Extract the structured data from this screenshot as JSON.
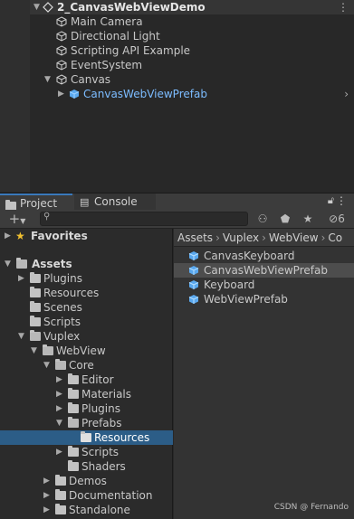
{
  "hierarchy": {
    "scene_name": "2_CanvasWebViewDemo",
    "items": [
      {
        "label": "Main Camera"
      },
      {
        "label": "Directional Light"
      },
      {
        "label": "Scripting API Example"
      },
      {
        "label": "EventSystem"
      },
      {
        "label": "Canvas"
      },
      {
        "label": "CanvasWebViewPrefab"
      }
    ]
  },
  "tabs": [
    {
      "label": "Project",
      "icon": "folder-icon"
    },
    {
      "label": "Console",
      "icon": "console-icon"
    }
  ],
  "toolbar": {
    "add_label": "+",
    "hidden_count": "6",
    "search_value": ""
  },
  "tree": {
    "favorites": "Favorites",
    "assets": "Assets",
    "items": [
      "Plugins",
      "Resources",
      "Scenes",
      "Scripts",
      "Vuplex",
      "WebView",
      "Core",
      "Editor",
      "Materials",
      "Plugins",
      "Prefabs",
      "Resources",
      "Scripts",
      "Shaders",
      "Demos",
      "Documentation",
      "Standalone"
    ]
  },
  "breadcrumb": [
    "Assets",
    "Vuplex",
    "WebView",
    "Co"
  ],
  "assets_list": [
    "CanvasKeyboard",
    "CanvasWebViewPrefab",
    "Keyboard",
    "WebViewPrefab"
  ],
  "watermark": "CSDN @ Fernando",
  "colors": {
    "accent": "#3a79bb",
    "selected_row": "#2c5d87",
    "prefab_blue": "#6fb8ff"
  }
}
